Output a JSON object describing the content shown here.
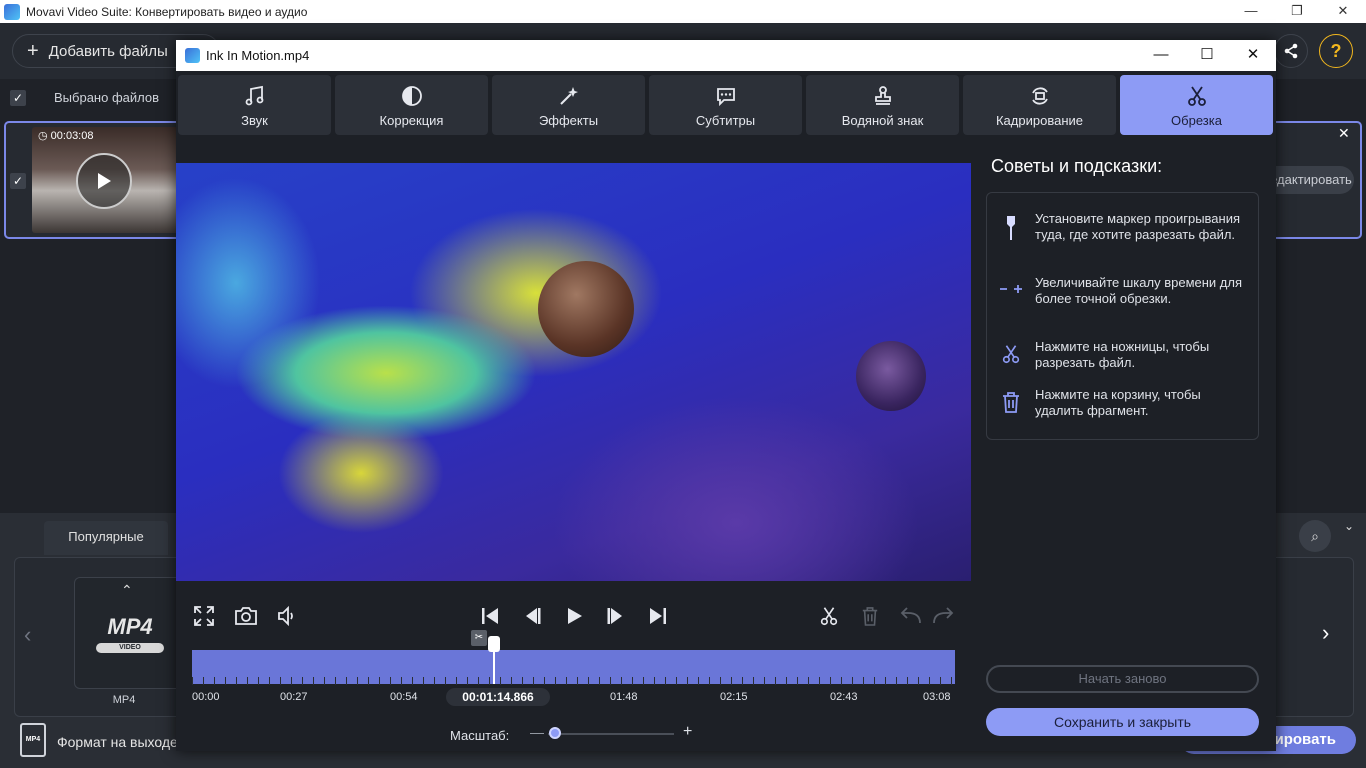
{
  "app": {
    "title": "Movavi Video Suite: Конвертировать видео и аудио",
    "window_controls": [
      "—",
      "❐",
      "✕"
    ],
    "add_files": "Добавить файлы",
    "selected_files": "Выбрано файлов",
    "edit_button": "Редактировать",
    "file_duration": "00:03:08",
    "popular_tab": "Популярные",
    "format_tile_logo": "MP4",
    "format_tile_sub": "VIDEO",
    "format_tile_caption": "MP4",
    "output_format_label": "Формат на выходе",
    "convert_button": "Конвертировать",
    "help": "?"
  },
  "dialog": {
    "title": "Ink In Motion.mp4",
    "tabs": [
      {
        "label": "Звук",
        "icon": "music-note-icon"
      },
      {
        "label": "Коррекция",
        "icon": "contrast-icon"
      },
      {
        "label": "Эффекты",
        "icon": "magic-wand-icon"
      },
      {
        "label": "Субтитры",
        "icon": "speech-bubble-icon"
      },
      {
        "label": "Водяной знак",
        "icon": "stamp-icon"
      },
      {
        "label": "Кадрирование",
        "icon": "rotate-crop-icon"
      },
      {
        "label": "Обрезка",
        "icon": "scissors-icon",
        "active": true
      }
    ],
    "tips_title": "Советы и подсказки:",
    "tips": [
      {
        "icon": "marker-icon",
        "text": "Установите маркер проигрывания туда, где хотите разрезать файл."
      },
      {
        "icon": "zoom-timeline-icon",
        "text": "Увеличивайте шкалу времени для более точной обрезки."
      },
      {
        "icon": "scissors-icon",
        "text": "Нажмите на ножницы, чтобы разрезать файл."
      },
      {
        "icon": "trash-icon",
        "text": "Нажмите на корзину, чтобы удалить фрагмент."
      }
    ],
    "restart_button": "Начать заново",
    "save_button": "Сохранить и закрыть",
    "timeline": {
      "labels": [
        "00:00",
        "00:27",
        "00:54",
        "01:48",
        "02:15",
        "02:43",
        "03:08"
      ],
      "current_time": "00:01:14.866",
      "playhead_fraction": 0.397
    },
    "scale_label": "Масштаб:",
    "scale_level": 0.05
  }
}
